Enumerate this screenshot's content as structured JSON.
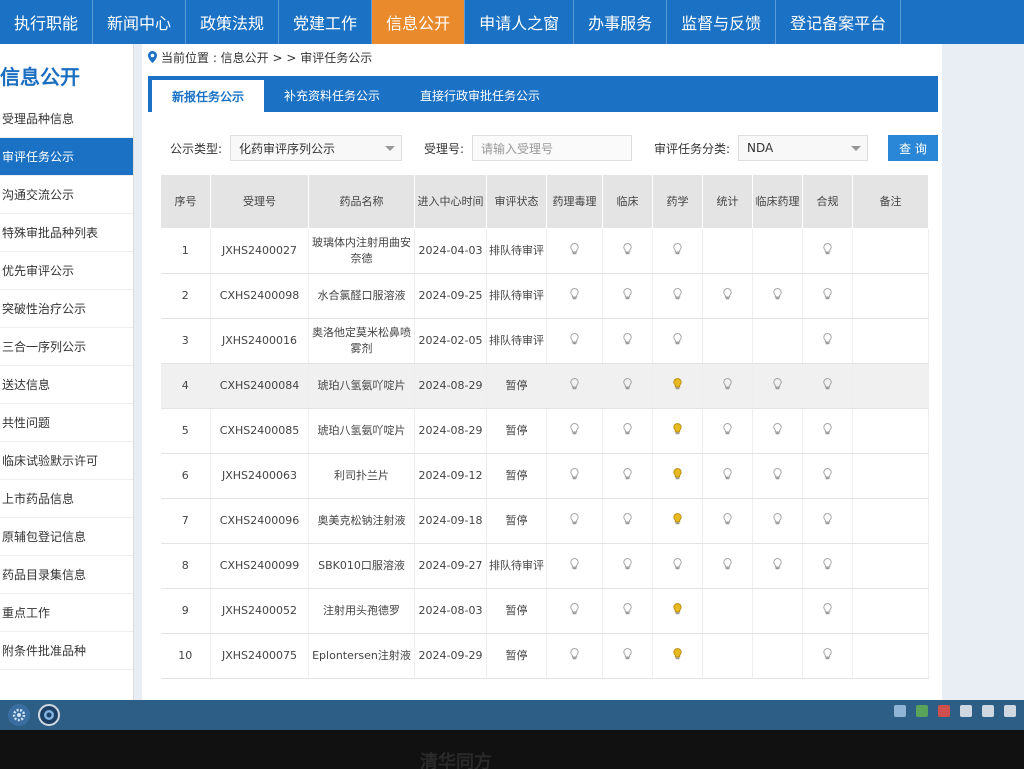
{
  "topnav": {
    "items": [
      {
        "label": "执行职能"
      },
      {
        "label": "新闻中心"
      },
      {
        "label": "政策法规"
      },
      {
        "label": "党建工作"
      },
      {
        "label": "信息公开",
        "active": true
      },
      {
        "label": "申请人之窗"
      },
      {
        "label": "办事服务"
      },
      {
        "label": "监督与反馈"
      },
      {
        "label": "登记备案平台"
      }
    ]
  },
  "sidebar": {
    "title": "信息公开",
    "items": [
      {
        "label": "受理品种信息"
      },
      {
        "label": "审评任务公示",
        "active": true
      },
      {
        "label": "沟通交流公示"
      },
      {
        "label": "特殊审批品种列表"
      },
      {
        "label": "优先审评公示"
      },
      {
        "label": "突破性治疗公示"
      },
      {
        "label": "三合一序列公示"
      },
      {
        "label": "送达信息"
      },
      {
        "label": "共性问题"
      },
      {
        "label": "临床试验默示许可"
      },
      {
        "label": "上市药品信息"
      },
      {
        "label": "原辅包登记信息"
      },
      {
        "label": "药品目录集信息"
      },
      {
        "label": "重点工作"
      },
      {
        "label": "附条件批准品种"
      }
    ]
  },
  "breadcrumb": {
    "text": "当前位置 : 信息公开 > > 审评任务公示"
  },
  "tabs": [
    {
      "label": "新报任务公示",
      "active": true
    },
    {
      "label": "补充资料任务公示"
    },
    {
      "label": "直接行政审批任务公示"
    }
  ],
  "filters": {
    "type_label": "公示类型:",
    "type_value": "化药审评序列公示",
    "accept_label": "受理号:",
    "accept_placeholder": "请输入受理号",
    "category_label": "审评任务分类:",
    "category_value": "NDA",
    "query_button": "查 询"
  },
  "table": {
    "headers": [
      "序号",
      "受理号",
      "药品名称",
      "进入中心时间",
      "审评状态",
      "药理毒理",
      "临床",
      "药学",
      "统计",
      "临床药理",
      "合规",
      "备注"
    ],
    "rows": [
      {
        "no": "1",
        "acc": "JXHS2400027",
        "name": "玻璃体内注射用曲安奈德",
        "date": "2024-04-03",
        "status": "排队待审评",
        "lights": [
          "grey",
          "grey",
          "grey",
          "",
          "",
          "grey"
        ]
      },
      {
        "no": "2",
        "acc": "CXHS2400098",
        "name": "水合氯醛口服溶液",
        "date": "2024-09-25",
        "status": "排队待审评",
        "lights": [
          "grey",
          "grey",
          "grey",
          "grey",
          "grey",
          "grey"
        ]
      },
      {
        "no": "3",
        "acc": "JXHS2400016",
        "name": "奥洛他定莫米松鼻喷雾剂",
        "date": "2024-02-05",
        "status": "排队待审评",
        "lights": [
          "grey",
          "grey",
          "grey",
          "",
          "",
          "grey"
        ]
      },
      {
        "no": "4",
        "acc": "CXHS2400084",
        "name": "琥珀八氢氨吖啶片",
        "date": "2024-08-29",
        "status": "暂停",
        "lights": [
          "grey",
          "grey",
          "yellow",
          "grey",
          "grey",
          "grey"
        ]
      },
      {
        "no": "5",
        "acc": "CXHS2400085",
        "name": "琥珀八氢氨吖啶片",
        "date": "2024-08-29",
        "status": "暂停",
        "lights": [
          "grey",
          "grey",
          "yellow",
          "grey",
          "grey",
          "grey"
        ]
      },
      {
        "no": "6",
        "acc": "JXHS2400063",
        "name": "利司扑兰片",
        "date": "2024-09-12",
        "status": "暂停",
        "lights": [
          "grey",
          "grey",
          "yellow",
          "grey",
          "grey",
          "grey"
        ]
      },
      {
        "no": "7",
        "acc": "CXHS2400096",
        "name": "奥美克松钠注射液",
        "date": "2024-09-18",
        "status": "暂停",
        "lights": [
          "grey",
          "grey",
          "yellow",
          "grey",
          "grey",
          "grey"
        ]
      },
      {
        "no": "8",
        "acc": "CXHS2400099",
        "name": "SBK010口服溶液",
        "date": "2024-09-27",
        "status": "排队待审评",
        "lights": [
          "grey",
          "grey",
          "grey",
          "grey",
          "grey",
          "grey"
        ]
      },
      {
        "no": "9",
        "acc": "JXHS2400052",
        "name": "注射用头孢德罗",
        "date": "2024-08-03",
        "status": "暂停",
        "lights": [
          "grey",
          "grey",
          "yellow",
          "",
          "",
          "grey"
        ]
      },
      {
        "no": "10",
        "acc": "JXHS2400075",
        "name": "Eplontersen注射液",
        "date": "2024-09-29",
        "status": "暂停",
        "lights": [
          "grey",
          "grey",
          "yellow",
          "",
          "",
          "grey"
        ]
      }
    ]
  },
  "colors": {
    "primary": "#1b72c4",
    "active_nav": "#e98a2d",
    "bulb_grey": "#9a9a9a",
    "bulb_yellow": "#e8b920"
  },
  "bezel": {
    "text": "清华同方"
  }
}
